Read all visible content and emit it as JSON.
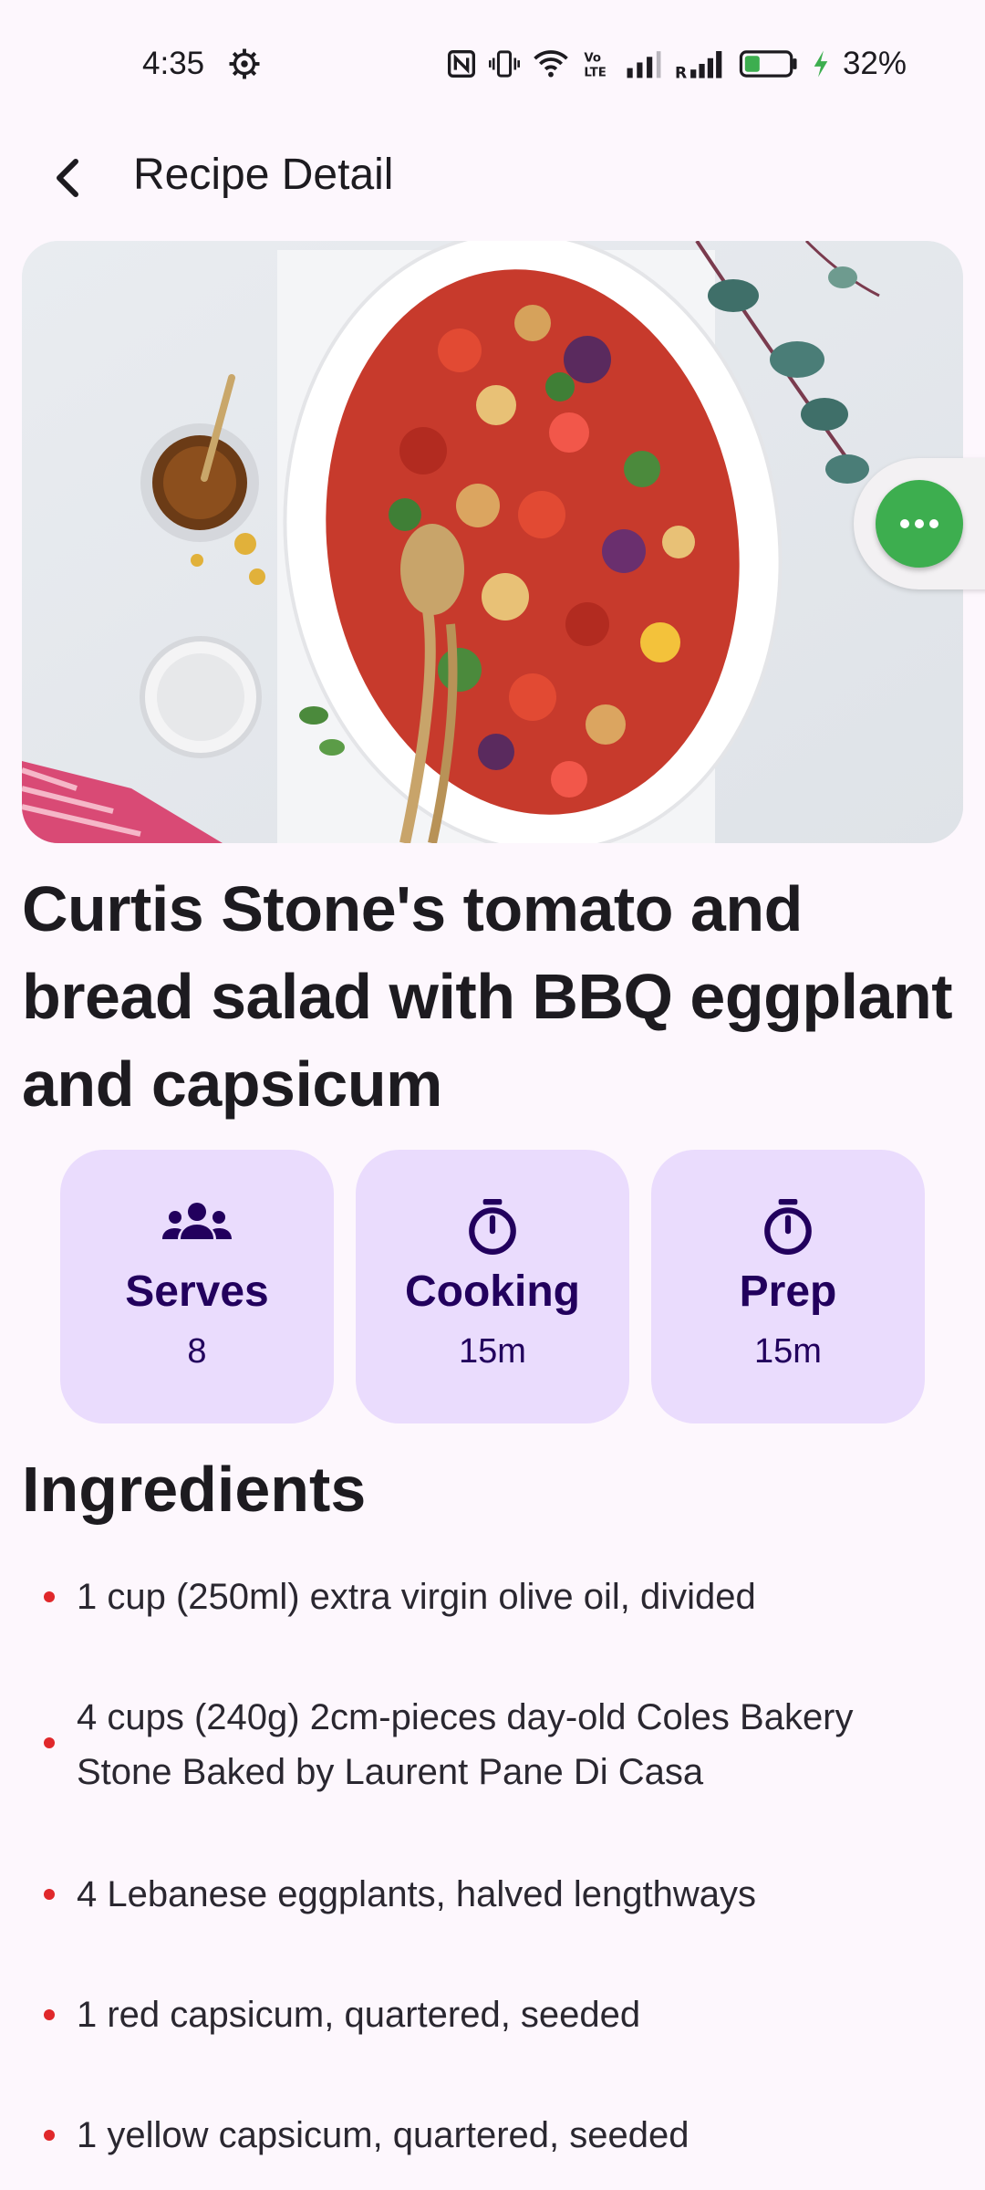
{
  "status_bar": {
    "time": "4:35",
    "battery_percent": "32%",
    "icons": [
      "settings-icon",
      "nfc-icon",
      "vibrate-icon",
      "wifi-icon",
      "volte-icon",
      "signal-icon",
      "roaming-signal-icon",
      "battery-icon",
      "charging-icon"
    ]
  },
  "app_bar": {
    "title": "Recipe Detail",
    "back_icon": "back-arrow-icon"
  },
  "hero": {
    "fab_icon": "more-horizontal-icon",
    "fab_color": "#3dae4f"
  },
  "recipe": {
    "title": "Curtis Stone's tomato and bread salad with BBQ eggplant and capsicum"
  },
  "info_cards": [
    {
      "icon": "people-icon",
      "label": "Serves",
      "value": "8"
    },
    {
      "icon": "timer-icon",
      "label": "Cooking",
      "value": "15m"
    },
    {
      "icon": "timer-icon",
      "label": "Prep",
      "value": "15m"
    }
  ],
  "ingredients": {
    "heading": "Ingredients",
    "items": [
      "1 cup (250ml) extra virgin olive oil, divided",
      "4 cups (240g) 2cm-pieces day-old Coles Bakery Stone Baked by Laurent Pane Di Casa",
      "4 Lebanese eggplants, halved lengthways",
      "1 red capsicum, quartered, seeded",
      "1 yellow capsicum, quartered, seeded"
    ]
  },
  "colors": {
    "background": "#fdf7fd",
    "card_bg": "#eadcfd",
    "card_text": "#22005d",
    "bullet": "#e0282b"
  }
}
